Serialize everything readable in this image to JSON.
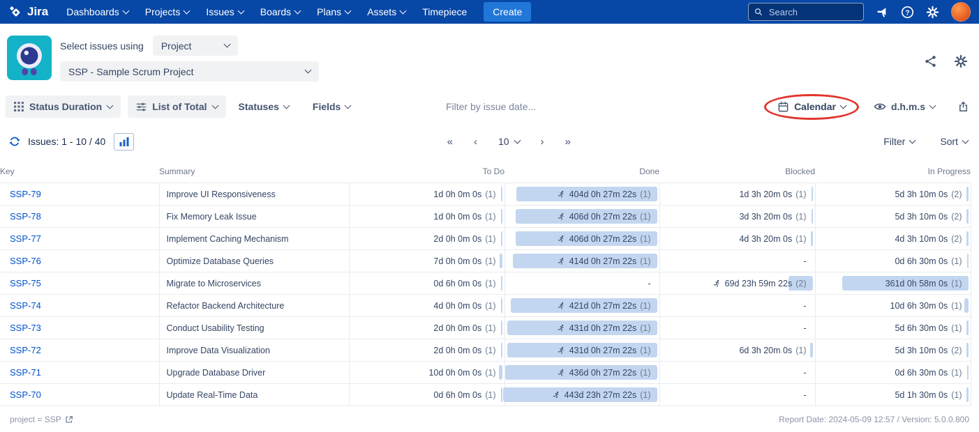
{
  "colors": {
    "nav_bg": "#0747A6",
    "create_button": "#2077D8",
    "link": "#0052CC",
    "bar_fill": "#C3D6F0",
    "annotation_red": "#E2342B",
    "app_icon_teal": "#14B2C7"
  },
  "icons": {
    "jira-logo": "diamond-mark",
    "search-icon": "magnifier",
    "megaphone-icon": "feedback-megaphone",
    "help-icon": "question-circle",
    "gear-icon": "settings-gear",
    "avatar": "orange-circle",
    "app-logo": "teal-mascot",
    "share-icon": "share-nodes",
    "grid-icon": "3x3-grid",
    "sliders-icon": "filter-sliders",
    "calendar-icon": "calendar",
    "eye-icon": "eye",
    "export-icon": "box-arrow-up",
    "refresh-icon": "circular-arrows",
    "chart-icon": "bar-chart",
    "runner-icon": "person-running",
    "external-link-icon": "box-arrow-out"
  },
  "nav": {
    "brand": "Jira",
    "items": [
      {
        "label": "Dashboards",
        "chevron": true
      },
      {
        "label": "Projects",
        "chevron": true
      },
      {
        "label": "Issues",
        "chevron": true
      },
      {
        "label": "Boards",
        "chevron": true
      },
      {
        "label": "Plans",
        "chevron": true
      },
      {
        "label": "Assets",
        "chevron": true
      },
      {
        "label": "Timepiece",
        "chevron": false
      }
    ],
    "create_label": "Create",
    "search_placeholder": "Search"
  },
  "app_header": {
    "select_label": "Select issues using",
    "mode_value": "Project",
    "project_value": "SSP - Sample Scrum Project"
  },
  "toolbar": {
    "status_duration_label": "Status Duration",
    "list_of_total_label": "List of Total",
    "statuses_label": "Statuses",
    "fields_label": "Fields",
    "date_filter_placeholder": "Filter by issue date...",
    "calendar_label": "Calendar",
    "time_format_label": "d.h.m.s"
  },
  "pagination": {
    "issues_label": "Issues: 1 - 10 / 40",
    "first": "«",
    "prev": "‹",
    "page_size": "10",
    "next": "›",
    "last": "»",
    "filter_label": "Filter",
    "sort_label": "Sort"
  },
  "table": {
    "columns": [
      "Key",
      "Summary",
      "To Do",
      "Done",
      "Blocked",
      "In Progress"
    ],
    "max_days": 444,
    "rows": [
      {
        "key": "SSP-79",
        "summary": "Improve UI Responsiveness",
        "cells": [
          {
            "text": "1d 0h 0m 0s",
            "count": "(1)",
            "days": 1
          },
          {
            "text": "404d 0h 27m 22s",
            "count": "(1)",
            "days": 404,
            "runner": true
          },
          {
            "text": "1d 3h 20m 0s",
            "count": "(1)",
            "days": 1.14
          },
          {
            "text": "5d 3h 10m 0s",
            "count": "(2)",
            "days": 5.13
          }
        ]
      },
      {
        "key": "SSP-78",
        "summary": "Fix Memory Leak Issue",
        "cells": [
          {
            "text": "1d 0h 0m 0s",
            "count": "(1)",
            "days": 1
          },
          {
            "text": "406d 0h 27m 22s",
            "count": "(1)",
            "days": 406,
            "runner": true
          },
          {
            "text": "3d 3h 20m 0s",
            "count": "(1)",
            "days": 3.14
          },
          {
            "text": "5d 3h 10m 0s",
            "count": "(2)",
            "days": 5.13
          }
        ]
      },
      {
        "key": "SSP-77",
        "summary": "Implement Caching Mechanism",
        "cells": [
          {
            "text": "2d 0h 0m 0s",
            "count": "(1)",
            "days": 2
          },
          {
            "text": "406d 0h 27m 22s",
            "count": "(1)",
            "days": 406,
            "runner": true
          },
          {
            "text": "4d 3h 20m 0s",
            "count": "(1)",
            "days": 4.14
          },
          {
            "text": "4d 3h 10m 0s",
            "count": "(2)",
            "days": 4.13
          }
        ]
      },
      {
        "key": "SSP-76",
        "summary": "Optimize Database Queries",
        "cells": [
          {
            "text": "7d 0h 0m 0s",
            "count": "(1)",
            "days": 7
          },
          {
            "text": "414d 0h 27m 22s",
            "count": "(1)",
            "days": 414,
            "runner": true
          },
          {
            "text": "-"
          },
          {
            "text": "0d 6h 30m 0s",
            "count": "(1)",
            "days": 0.27
          }
        ]
      },
      {
        "key": "SSP-75",
        "summary": "Migrate to Microservices",
        "cells": [
          {
            "text": "0d 6h 0m 0s",
            "count": "(1)",
            "days": 0.25
          },
          {
            "text": "-"
          },
          {
            "text": "69d 23h 59m 22s",
            "count": "(2)",
            "days": 70,
            "runner": true
          },
          {
            "text": "361d 0h 58m 0s",
            "count": "(1)",
            "days": 361
          }
        ]
      },
      {
        "key": "SSP-74",
        "summary": "Refactor Backend Architecture",
        "cells": [
          {
            "text": "4d 0h 0m 0s",
            "count": "(1)",
            "days": 4
          },
          {
            "text": "421d 0h 27m 22s",
            "count": "(1)",
            "days": 421,
            "runner": true
          },
          {
            "text": "-"
          },
          {
            "text": "10d 6h 30m 0s",
            "count": "(1)",
            "days": 10.27
          }
        ]
      },
      {
        "key": "SSP-73",
        "summary": "Conduct Usability Testing",
        "cells": [
          {
            "text": "2d 0h 0m 0s",
            "count": "(1)",
            "days": 2
          },
          {
            "text": "431d 0h 27m 22s",
            "count": "(1)",
            "days": 431,
            "runner": true
          },
          {
            "text": "-"
          },
          {
            "text": "5d 6h 30m 0s",
            "count": "(1)",
            "days": 5.27
          }
        ]
      },
      {
        "key": "SSP-72",
        "summary": "Improve Data Visualization",
        "cells": [
          {
            "text": "2d 0h 0m 0s",
            "count": "(1)",
            "days": 2
          },
          {
            "text": "431d 0h 27m 22s",
            "count": "(1)",
            "days": 431,
            "runner": true
          },
          {
            "text": "6d 3h 20m 0s",
            "count": "(1)",
            "days": 6.14
          },
          {
            "text": "5d 3h 10m 0s",
            "count": "(2)",
            "days": 5.13
          }
        ]
      },
      {
        "key": "SSP-71",
        "summary": "Upgrade Database Driver",
        "cells": [
          {
            "text": "10d 0h 0m 0s",
            "count": "(1)",
            "days": 10
          },
          {
            "text": "436d 0h 27m 22s",
            "count": "(1)",
            "days": 436,
            "runner": true
          },
          {
            "text": "-"
          },
          {
            "text": "0d 6h 30m 0s",
            "count": "(1)",
            "days": 0.27
          }
        ]
      },
      {
        "key": "SSP-70",
        "summary": "Update Real-Time Data",
        "cells": [
          {
            "text": "0d 6h 0m 0s",
            "count": "(1)",
            "days": 0.25
          },
          {
            "text": "443d 23h 27m 22s",
            "count": "(1)",
            "days": 443.98,
            "runner": true
          },
          {
            "text": "-"
          },
          {
            "text": "5d 1h 30m 0s",
            "count": "(1)",
            "days": 5.06
          }
        ]
      }
    ]
  },
  "footer": {
    "left": "project = SSP",
    "right": "Report Date: 2024-05-09 12:57 / Version: 5.0.0.800"
  }
}
